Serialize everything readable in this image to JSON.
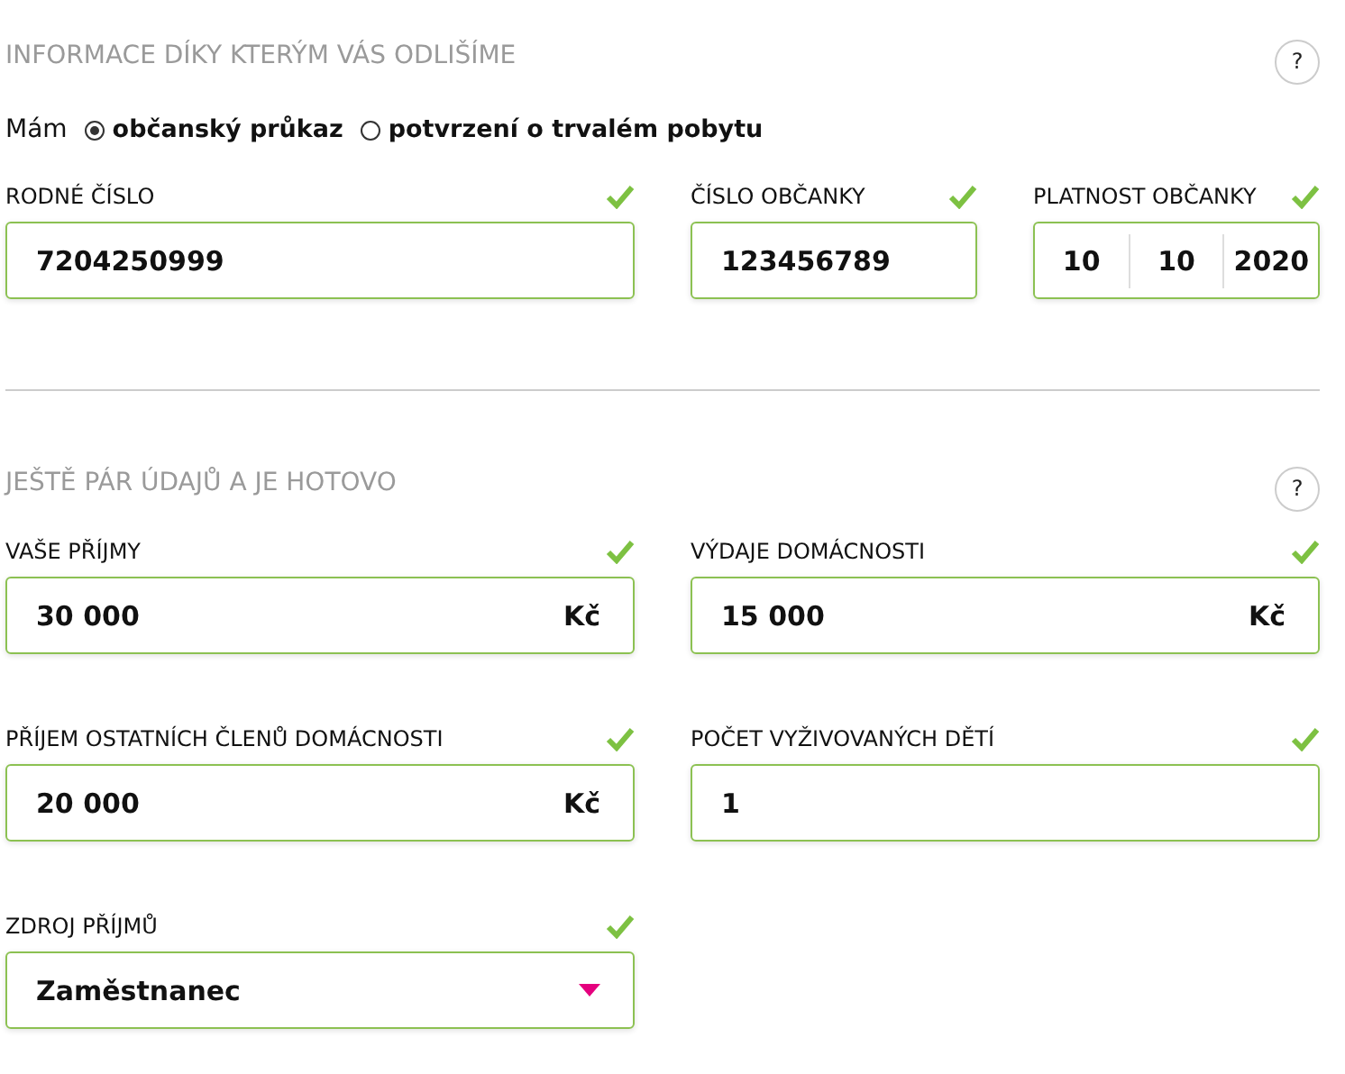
{
  "sections": [
    {
      "title": "INFORMACE DÍKY KTERÝM VÁS ODLIŠÍME",
      "help": "?",
      "radio_group": {
        "label": "Mám",
        "options": [
          {
            "label": "občanský průkaz",
            "selected": true
          },
          {
            "label": "potvrzení o trvalém pobytu",
            "selected": false
          }
        ]
      },
      "fields": [
        {
          "kind": "text",
          "label": "RODNÉ ČÍSLO",
          "valid": true,
          "value": "7204250999"
        },
        {
          "kind": "text",
          "label": "ČÍSLO OBČANKY",
          "valid": true,
          "value": "123456789"
        },
        {
          "kind": "date",
          "label": "PLATNOST OBČANKY",
          "valid": true,
          "parts": [
            "10",
            "10",
            "2020"
          ]
        }
      ]
    },
    {
      "title": "JEŠTĚ PÁR ÚDAJŮ A JE HOTOVO",
      "help": "?",
      "fields": [
        {
          "kind": "currency",
          "label": "VAŠE PŘÍJMY",
          "valid": true,
          "value": "30 000",
          "unit": "Kč"
        },
        {
          "kind": "currency",
          "label": "VÝDAJE DOMÁCNOSTI",
          "valid": true,
          "value": "15 000",
          "unit": "Kč"
        },
        {
          "kind": "currency",
          "label": "PŘÍJEM OSTATNÍCH ČLENŮ DOMÁCNOSTI",
          "valid": true,
          "value": "20 000",
          "unit": "Kč"
        },
        {
          "kind": "text",
          "label": "POČET VYŽIVOVANÝCH DĚTÍ",
          "valid": true,
          "value": "1"
        },
        {
          "kind": "select",
          "label": "ZDROJ PŘÍJMŮ",
          "valid": true,
          "value": "Zaměstnanec"
        }
      ]
    }
  ]
}
